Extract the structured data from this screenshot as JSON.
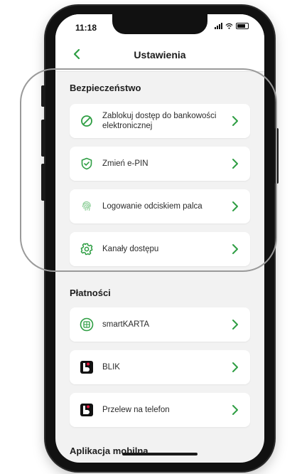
{
  "status_bar": {
    "time": "11:18"
  },
  "header": {
    "title": "Ustawienia"
  },
  "sections": {
    "security": {
      "title": "Bezpieczeństwo",
      "items": [
        {
          "label": "Zablokuj dostęp do bankowości elektronicznej",
          "icon": "block-icon"
        },
        {
          "label": "Zmień e-PIN",
          "icon": "shield-check-icon"
        },
        {
          "label": "Logowanie odciskiem palca",
          "icon": "fingerprint-icon"
        },
        {
          "label": "Kanały dostępu",
          "icon": "gear-icon"
        }
      ]
    },
    "payments": {
      "title": "Płatności",
      "items": [
        {
          "label": "smartKARTA",
          "icon": "card-chip-icon"
        },
        {
          "label": "BLIK",
          "icon": "blik-logo-icon"
        },
        {
          "label": "Przelew na telefon",
          "icon": "blik-logo-icon"
        }
      ]
    },
    "mobile_app": {
      "title": "Aplikacja mobilna"
    }
  },
  "colors": {
    "accent": "#2e9e43",
    "background": "#f2f2f2",
    "card": "#ffffff"
  }
}
